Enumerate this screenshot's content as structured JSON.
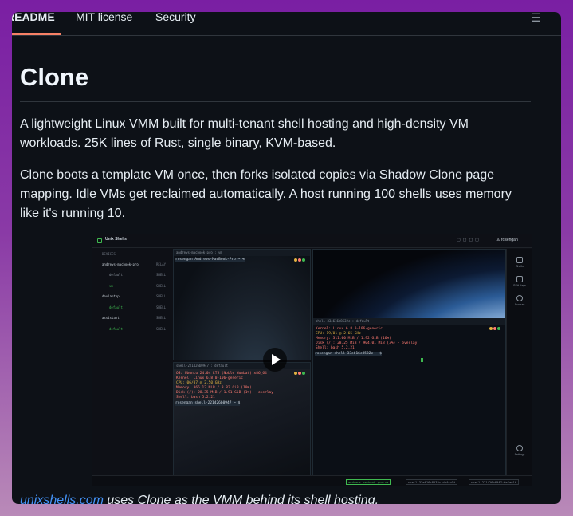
{
  "tabs": {
    "readme": "README",
    "license": "MIT license",
    "security": "Security"
  },
  "article": {
    "heading": "Clone",
    "paragraph1": "A lightweight Linux VMM built for multi-tenant shell hosting and high-density VM workloads. 25K lines of Rust, single binary, KVM-based.",
    "paragraph2": "Clone boots a template VM once, then forks isolated copies via Shadow Clone page mapping. Idle VMs get reclaimed automatically. A host running 100 shells uses memory like it's running 10.",
    "caption_link": "unixshells.com",
    "caption_rest": " uses Clone as the VMM behind its shell hosting."
  },
  "screenshot": {
    "app_title": "Unix Shells",
    "user": "rosengan",
    "sidebar": {
      "section": "DEVICES",
      "items": [
        {
          "label": "andrews-macbook-pro",
          "tag": "RELAY"
        },
        {
          "label": "default",
          "tag": "SHELL"
        },
        {
          "label": "vm",
          "tag": "SHELL"
        },
        {
          "label": "devlaptop",
          "tag": "SHELL"
        },
        {
          "label": "default",
          "tag": "SHELL"
        },
        {
          "label": "assistant",
          "tag": "SHELL"
        },
        {
          "label": "default",
          "tag": "SHELL"
        }
      ]
    },
    "pane1": {
      "title": "andrews-macbook-pro : vm",
      "prompt": "rosengan  Andrews-MacBook-Pro   ~   %"
    },
    "pane2": {
      "title": "shell-221426b0947 : default",
      "lines": [
        "OS: Ubuntu 24.04 LTS (Noble Numbat) x86_64",
        "Kernel: Linux 6.8.0-106-generic",
        "CPU: 06/07 @ 2.50 GHz",
        "Memory: 365.12 MiB / 3.82 GiB (10%)",
        "Disk (/): 28.35 MiB / 1.91 GiB (1%) - overlay",
        "Shell: bash 5.2.21"
      ],
      "prompt": "rosengan  shell-221426b0947   ~   $"
    },
    "pane3": {
      "title": "shell-33e616c8532c : default",
      "lines": [
        "Kernel: Linux 6.8.0-106-generic",
        "CPU: 19/01 @ 2.65 GHz",
        "Memory: 311.00 MiB / 1.92 GiB (16%)",
        "Disk (/): 28.25 MiB / 904.01 MiB (3%) - overlay",
        "Shell: bash 5.2.21"
      ],
      "prompt": "rosengan  shell-33e616c8532c   ~   $"
    },
    "rail": {
      "shells": "Shells",
      "ssh_keys": "SSH Keys",
      "account": "Account",
      "settings": "Settings"
    },
    "status": {
      "item1": "andrews-macbook-pro:vm",
      "item2": "shell-33e616c8532c:default",
      "item3": "shell-221426b0947:default"
    }
  },
  "colors": {
    "accent": "#f78166",
    "link": "#4493f8",
    "term_green": "#3fb950",
    "term_red": "#ff7b72",
    "term_yellow": "#e3b341"
  }
}
